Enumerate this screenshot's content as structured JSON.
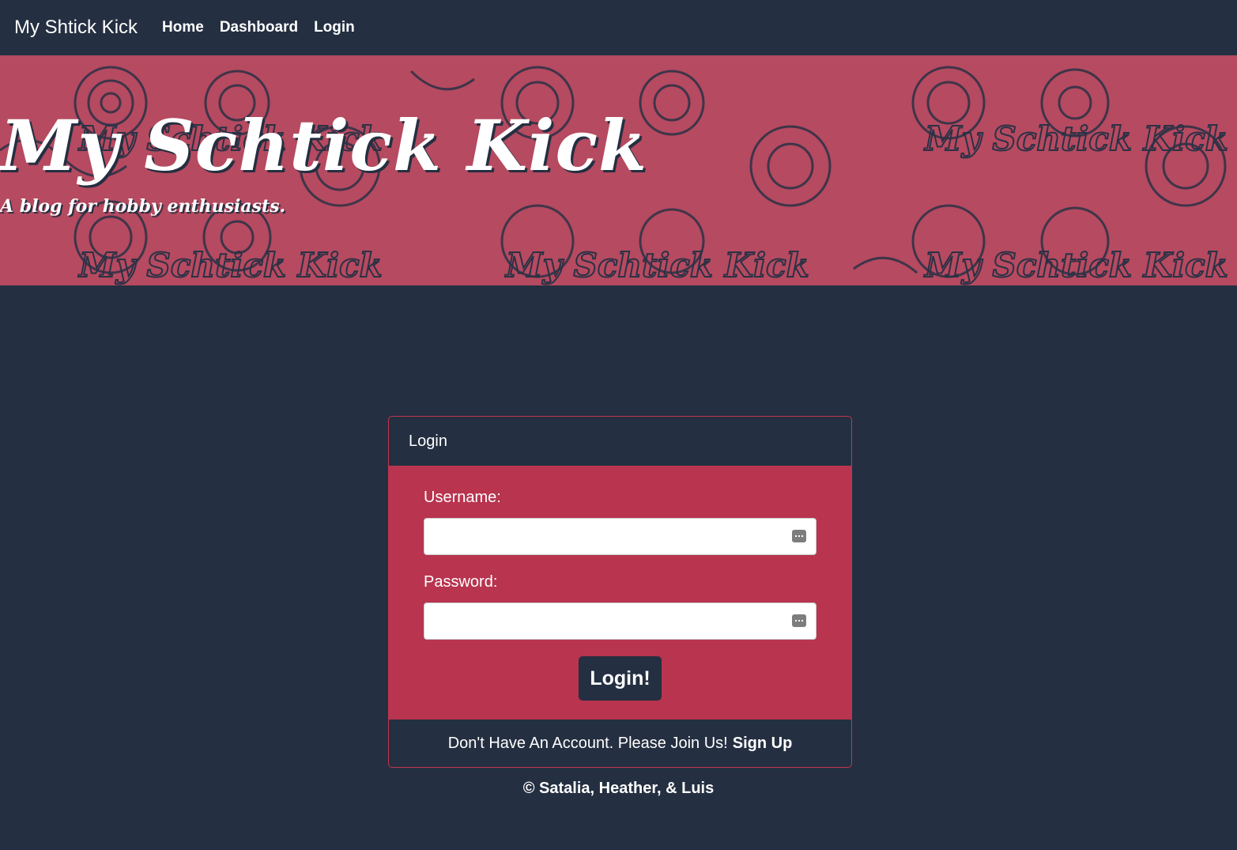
{
  "navbar": {
    "brand": "My Shtick Kick",
    "links": [
      "Home",
      "Dashboard",
      "Login"
    ]
  },
  "hero": {
    "title": "My Schtick Kick",
    "subtitle": "A blog for hobby enthusiasts.",
    "watermark": "My Schtick Kick"
  },
  "login_card": {
    "header": "Login",
    "username_label": "Username:",
    "username_value": "",
    "password_label": "Password:",
    "password_value": "",
    "submit_label": "Login!",
    "footer_text": "Don't Have An Account. Please Join Us!",
    "signup_link": "Sign Up"
  },
  "footer": {
    "copyright": "© Satalia, Heather, & Luis"
  },
  "colors": {
    "background": "#242f41",
    "accent": "#b8344f",
    "hero_pink": "#b54a60"
  },
  "icons": {
    "password_manager": "key-icon"
  }
}
